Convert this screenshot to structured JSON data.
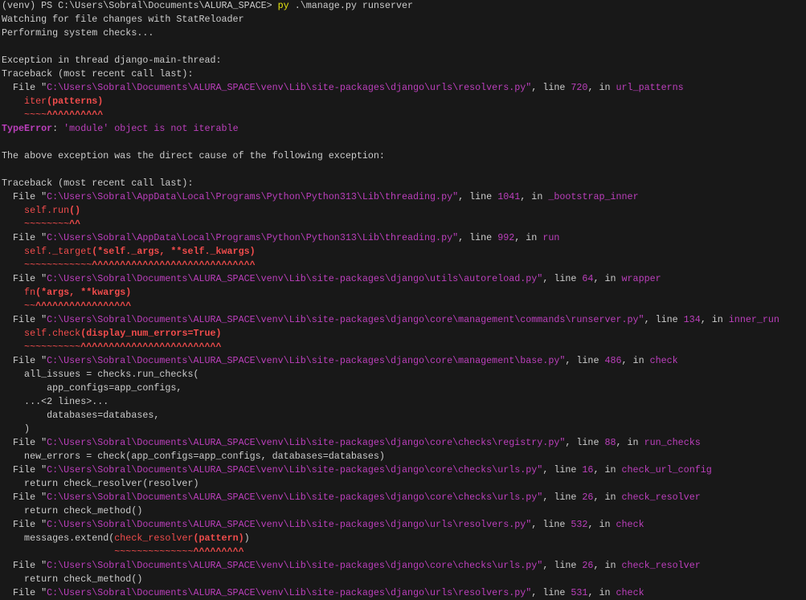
{
  "colors": {
    "background": "#181818",
    "foreground": "#cccccc",
    "magenta": "#bc3fbc",
    "red": "#f14c4c",
    "yellow": "#e5e510"
  },
  "terminal": {
    "lines": [
      {
        "segs": [
          [
            "(venv) PS C:\\Users\\Sobral\\Documents\\ALURA_SPACE> ",
            "fg"
          ],
          [
            "py",
            "yel"
          ],
          [
            " .\\manage.py runserver",
            "fg"
          ]
        ]
      },
      {
        "segs": [
          [
            "Watching for file changes with StatReloader",
            "fg"
          ]
        ]
      },
      {
        "segs": [
          [
            "Performing system checks...",
            "fg"
          ]
        ]
      },
      {
        "segs": []
      },
      {
        "segs": [
          [
            "Exception in thread django-main-thread:",
            "fg"
          ]
        ]
      },
      {
        "segs": [
          [
            "Traceback (most recent call last):",
            "fg"
          ]
        ]
      },
      {
        "frame": {
          "path": "C:\\Users\\Sobral\\Documents\\ALURA_SPACE\\venv\\Lib\\site-packages\\django\\urls\\resolvers.py",
          "line": "720",
          "func": "url_patterns"
        }
      },
      {
        "segs": [
          [
            "    iter",
            "red"
          ],
          [
            "(patterns)",
            "red b"
          ]
        ]
      },
      {
        "segs": [
          [
            "    ~~~~",
            "red"
          ],
          [
            "^^^^^^^^^^",
            "red b"
          ]
        ]
      },
      {
        "segs": [
          [
            "TypeError",
            "mag b"
          ],
          [
            ": ",
            "fg"
          ],
          [
            "'module' object is not iterable",
            "mag"
          ]
        ]
      },
      {
        "segs": []
      },
      {
        "segs": [
          [
            "The above exception was the direct cause of the following exception:",
            "fg"
          ]
        ]
      },
      {
        "segs": []
      },
      {
        "segs": [
          [
            "Traceback (most recent call last):",
            "fg"
          ]
        ]
      },
      {
        "frame": {
          "path": "C:\\Users\\Sobral\\AppData\\Local\\Programs\\Python\\Python313\\Lib\\threading.py",
          "line": "1041",
          "func": "_bootstrap_inner"
        }
      },
      {
        "segs": [
          [
            "    self.run",
            "red"
          ],
          [
            "()",
            "red b"
          ]
        ]
      },
      {
        "segs": [
          [
            "    ~~~~~~~~",
            "red"
          ],
          [
            "^^",
            "red b"
          ]
        ]
      },
      {
        "frame": {
          "path": "C:\\Users\\Sobral\\AppData\\Local\\Programs\\Python\\Python313\\Lib\\threading.py",
          "line": "992",
          "func": "run"
        }
      },
      {
        "segs": [
          [
            "    self._target",
            "red"
          ],
          [
            "(*self._args, **self._kwargs)",
            "red b"
          ]
        ]
      },
      {
        "segs": [
          [
            "    ~~~~~~~~~~~~",
            "red"
          ],
          [
            "^^^^^^^^^^^^^^^^^^^^^^^^^^^^^",
            "red b"
          ]
        ]
      },
      {
        "frame": {
          "path": "C:\\Users\\Sobral\\Documents\\ALURA_SPACE\\venv\\Lib\\site-packages\\django\\utils\\autoreload.py",
          "line": "64",
          "func": "wrapper"
        }
      },
      {
        "segs": [
          [
            "    fn",
            "red"
          ],
          [
            "(*args, **kwargs)",
            "red b"
          ]
        ]
      },
      {
        "segs": [
          [
            "    ~~",
            "red"
          ],
          [
            "^^^^^^^^^^^^^^^^^",
            "red b"
          ]
        ]
      },
      {
        "frame": {
          "path": "C:\\Users\\Sobral\\Documents\\ALURA_SPACE\\venv\\Lib\\site-packages\\django\\core\\management\\commands\\runserver.py",
          "line": "134",
          "func": "inner_run"
        }
      },
      {
        "segs": [
          [
            "    self.check",
            "red"
          ],
          [
            "(display_num_errors=True)",
            "red b"
          ]
        ]
      },
      {
        "segs": [
          [
            "    ~~~~~~~~~~",
            "red"
          ],
          [
            "^^^^^^^^^^^^^^^^^^^^^^^^^",
            "red b"
          ]
        ]
      },
      {
        "frame": {
          "path": "C:\\Users\\Sobral\\Documents\\ALURA_SPACE\\venv\\Lib\\site-packages\\django\\core\\management\\base.py",
          "line": "486",
          "func": "check"
        }
      },
      {
        "segs": [
          [
            "    all_issues = checks.run_checks(",
            "fg"
          ]
        ]
      },
      {
        "segs": [
          [
            "        app_configs=app_configs,",
            "fg"
          ]
        ]
      },
      {
        "segs": [
          [
            "    ...<2 lines>...",
            "fg"
          ]
        ]
      },
      {
        "segs": [
          [
            "        databases=databases,",
            "fg"
          ]
        ]
      },
      {
        "segs": [
          [
            "    )",
            "fg"
          ]
        ]
      },
      {
        "frame": {
          "path": "C:\\Users\\Sobral\\Documents\\ALURA_SPACE\\venv\\Lib\\site-packages\\django\\core\\checks\\registry.py",
          "line": "88",
          "func": "run_checks"
        }
      },
      {
        "segs": [
          [
            "    new_errors = check(app_configs=app_configs, databases=databases)",
            "fg"
          ]
        ]
      },
      {
        "frame": {
          "path": "C:\\Users\\Sobral\\Documents\\ALURA_SPACE\\venv\\Lib\\site-packages\\django\\core\\checks\\urls.py",
          "line": "16",
          "func": "check_url_config"
        }
      },
      {
        "segs": [
          [
            "    return check_resolver(resolver)",
            "fg"
          ]
        ]
      },
      {
        "frame": {
          "path": "C:\\Users\\Sobral\\Documents\\ALURA_SPACE\\venv\\Lib\\site-packages\\django\\core\\checks\\urls.py",
          "line": "26",
          "func": "check_resolver"
        }
      },
      {
        "segs": [
          [
            "    return check_method()",
            "fg"
          ]
        ]
      },
      {
        "frame": {
          "path": "C:\\Users\\Sobral\\Documents\\ALURA_SPACE\\venv\\Lib\\site-packages\\django\\urls\\resolvers.py",
          "line": "532",
          "func": "check"
        }
      },
      {
        "segs": [
          [
            "    messages.extend(",
            "fg"
          ],
          [
            "check_resolver",
            "red"
          ],
          [
            "(pattern)",
            "red b"
          ],
          [
            ")",
            "fg"
          ]
        ]
      },
      {
        "segs": [
          [
            "                    ~~~~~~~~~~~~~~",
            "red"
          ],
          [
            "^^^^^^^^^",
            "red b"
          ]
        ]
      },
      {
        "frame": {
          "path": "C:\\Users\\Sobral\\Documents\\ALURA_SPACE\\venv\\Lib\\site-packages\\django\\core\\checks\\urls.py",
          "line": "26",
          "func": "check_resolver"
        }
      },
      {
        "segs": [
          [
            "    return check_method()",
            "fg"
          ]
        ]
      },
      {
        "frame": {
          "path": "C:\\Users\\Sobral\\Documents\\ALURA_SPACE\\venv\\Lib\\site-packages\\django\\urls\\resolvers.py",
          "line": "531",
          "func": "check"
        }
      }
    ]
  }
}
